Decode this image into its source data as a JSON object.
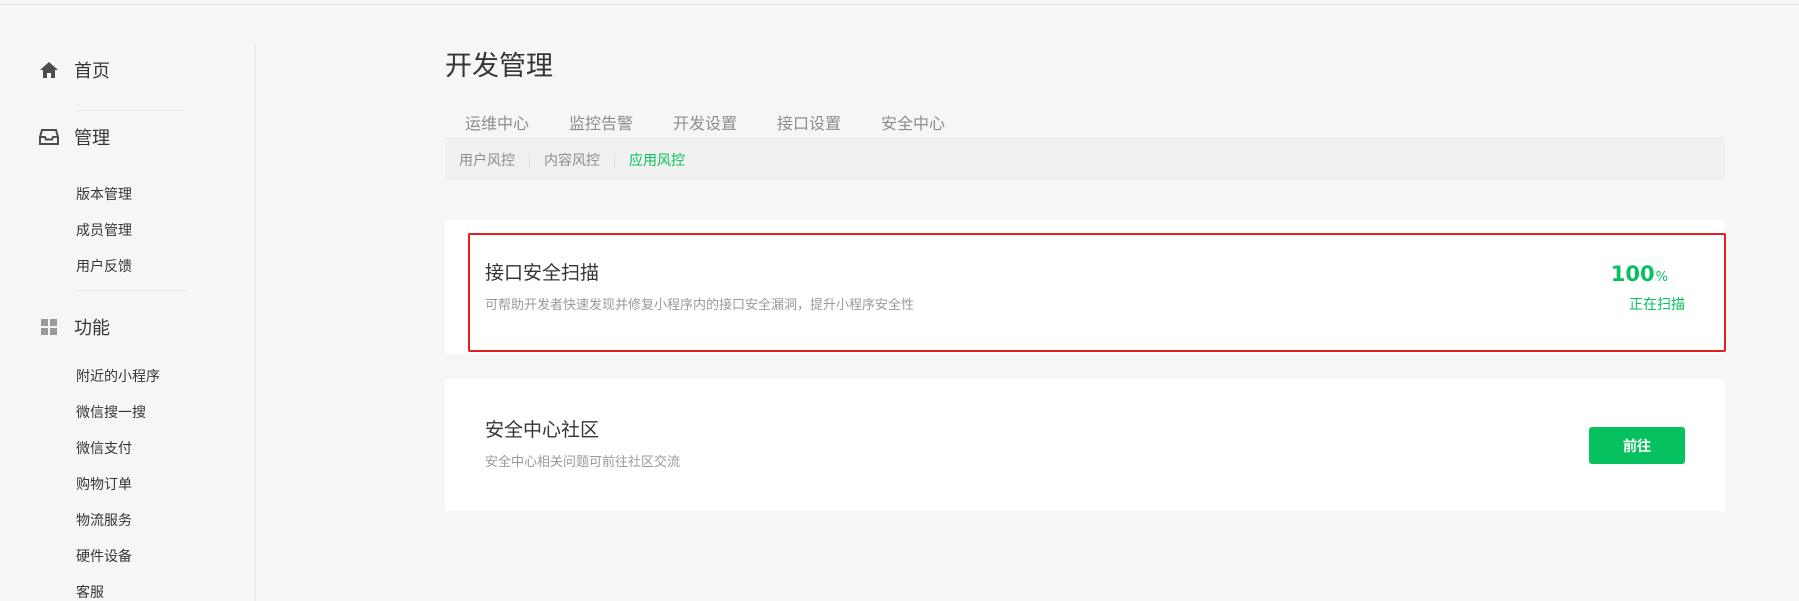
{
  "sidebar": {
    "sections": [
      {
        "label": "首页",
        "icon": "home-icon",
        "items": []
      },
      {
        "label": "管理",
        "icon": "inbox-icon",
        "items": [
          "版本管理",
          "成员管理",
          "用户反馈"
        ]
      },
      {
        "label": "功能",
        "icon": "grid-icon",
        "items": [
          "附近的小程序",
          "微信搜一搜",
          "微信支付",
          "购物订单",
          "物流服务",
          "硬件设备",
          "客服"
        ]
      }
    ]
  },
  "page": {
    "title": "开发管理",
    "tabs": [
      "运维中心",
      "监控告警",
      "开发设置",
      "接口设置",
      "安全中心"
    ],
    "subtabs": [
      "用户风控",
      "内容风控",
      "应用风控"
    ],
    "active_subtab": "应用风控"
  },
  "cards": [
    {
      "title": "接口安全扫描",
      "desc": "可帮助开发者快速发现并修复小程序内的接口安全漏洞，提升小程序安全性",
      "progress_value": "100",
      "progress_unit": "%",
      "status": "正在扫描"
    },
    {
      "title": "安全中心社区",
      "desc": "安全中心相关问题可前往社区交流",
      "button_label": "前往"
    }
  ],
  "colors": {
    "accent": "#07c160",
    "highlight_border": "#e71e1e",
    "background": "#f6f6f6"
  }
}
